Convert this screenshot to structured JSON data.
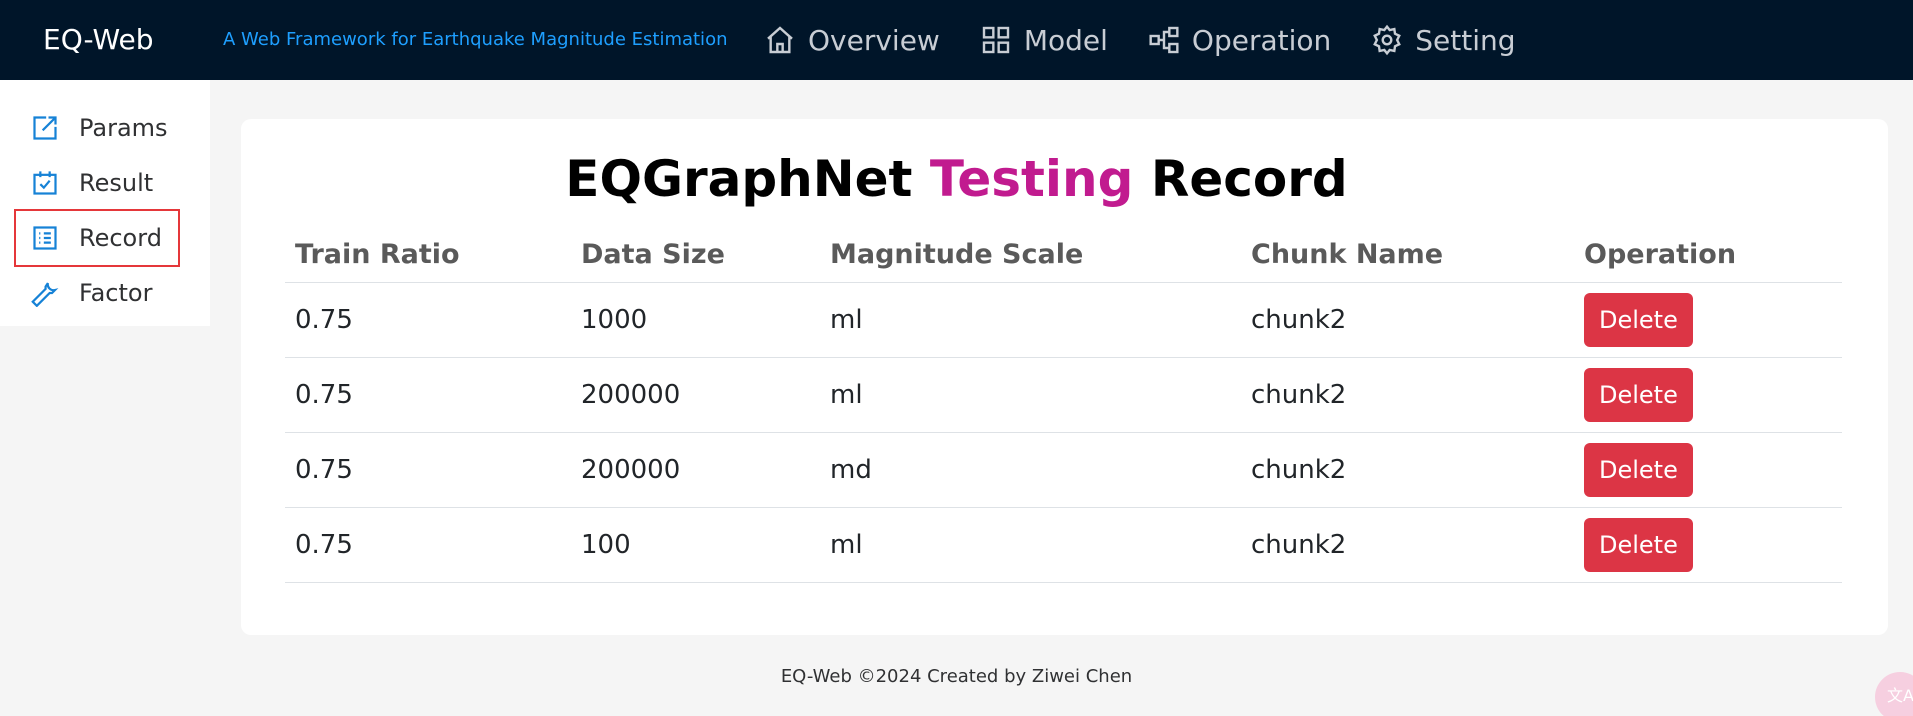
{
  "header": {
    "brand": "EQ-Web",
    "tagline": "A Web Framework for Earthquake Magnitude Estimation",
    "nav": [
      {
        "label": "Overview",
        "icon": "home-icon"
      },
      {
        "label": "Model",
        "icon": "grid-icon"
      },
      {
        "label": "Operation",
        "icon": "hierarchy-icon"
      },
      {
        "label": "Setting",
        "icon": "gear-icon"
      }
    ]
  },
  "sidebar": {
    "items": [
      {
        "label": "Params",
        "icon": "edit-icon"
      },
      {
        "label": "Result",
        "icon": "calendar-check-icon"
      },
      {
        "label": "Record",
        "icon": "list-icon",
        "active": true
      },
      {
        "label": "Factor",
        "icon": "wrench-icon"
      }
    ]
  },
  "main": {
    "title_part1": "EQGraphNet ",
    "title_highlight": "Testing",
    "title_part2": " Record",
    "columns": [
      "Train Ratio",
      "Data Size",
      "Magnitude Scale",
      "Chunk Name",
      "Operation"
    ],
    "rows": [
      {
        "train_ratio": "0.75",
        "data_size": "1000",
        "magnitude_scale": "ml",
        "chunk_name": "chunk2",
        "action": "Delete"
      },
      {
        "train_ratio": "0.75",
        "data_size": "200000",
        "magnitude_scale": "ml",
        "chunk_name": "chunk2",
        "action": "Delete"
      },
      {
        "train_ratio": "0.75",
        "data_size": "200000",
        "magnitude_scale": "md",
        "chunk_name": "chunk2",
        "action": "Delete"
      },
      {
        "train_ratio": "0.75",
        "data_size": "100",
        "magnitude_scale": "ml",
        "chunk_name": "chunk2",
        "action": "Delete"
      }
    ]
  },
  "footer": {
    "text": "EQ-Web ©2024 Created by Ziwei Chen"
  },
  "colors": {
    "header_bg": "#001529",
    "tagline": "#1e9fff",
    "highlight": "#c11b8f",
    "delete": "#dc3545",
    "sidebar_icon": "#1682d6"
  }
}
